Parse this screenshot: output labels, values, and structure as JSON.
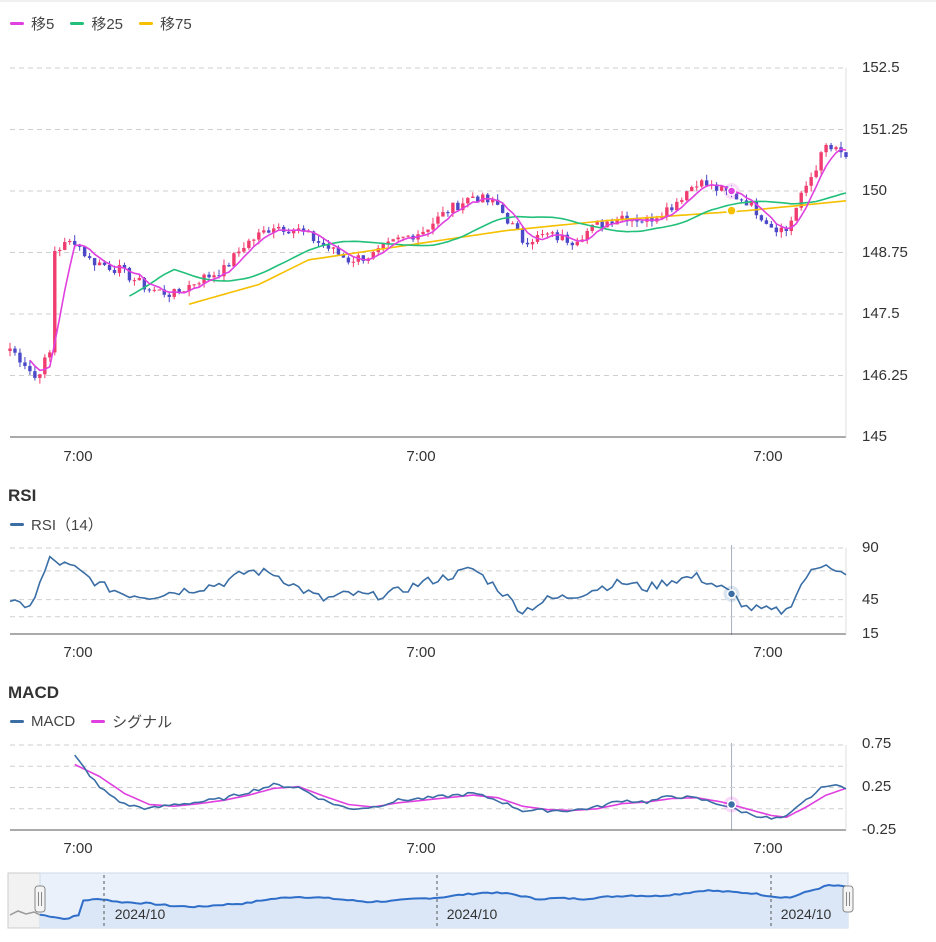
{
  "main": {
    "legend": [
      {
        "label": "移5",
        "color": "#e040e0"
      },
      {
        "label": "移25",
        "color": "#22c07a"
      },
      {
        "label": "移75",
        "color": "#f5c000"
      }
    ],
    "y_ticks": [
      "152.5",
      "151.25",
      "150",
      "148.75",
      "147.5",
      "146.25",
      "145"
    ],
    "x_ticks": [
      "7:00",
      "7:00",
      "7:00"
    ]
  },
  "rsi": {
    "title": "RSI",
    "legend": [
      {
        "label": "RSI（14）",
        "color": "#3a6ea5"
      }
    ],
    "y_ticks": [
      "90",
      "45",
      "15"
    ],
    "x_ticks": [
      "7:00",
      "7:00",
      "7:00"
    ]
  },
  "macd": {
    "title": "MACD",
    "legend": [
      {
        "label": "MACD",
        "color": "#3a6ea5"
      },
      {
        "label": "シグナル",
        "color": "#e040e0"
      }
    ],
    "y_ticks": [
      "0.75",
      "0.25",
      "-0.25"
    ],
    "x_ticks": [
      "7:00",
      "7:00",
      "7:00"
    ]
  },
  "navigator": {
    "date_labels": [
      "2024/10",
      "2024/10",
      "2024/10"
    ]
  },
  "chart_data": [
    {
      "type": "line",
      "name": "price",
      "ylim": [
        145,
        152.5
      ],
      "y_ticks": [
        152.5,
        151.25,
        150,
        148.75,
        147.5,
        146.25,
        145
      ],
      "price_keypoints": [
        [
          0,
          146.8
        ],
        [
          3,
          146.5
        ],
        [
          5,
          146.2
        ],
        [
          8,
          146.7
        ],
        [
          9,
          148.8
        ],
        [
          13,
          149.0
        ],
        [
          16,
          148.6
        ],
        [
          22,
          148.4
        ],
        [
          28,
          148.0
        ],
        [
          33,
          147.9
        ],
        [
          38,
          148.2
        ],
        [
          43,
          148.4
        ],
        [
          47,
          148.9
        ],
        [
          53,
          149.3
        ],
        [
          58,
          149.2
        ],
        [
          63,
          148.9
        ],
        [
          68,
          148.6
        ],
        [
          73,
          148.7
        ],
        [
          78,
          149.0
        ],
        [
          83,
          149.2
        ],
        [
          88,
          149.6
        ],
        [
          93,
          149.9
        ],
        [
          98,
          149.7
        ],
        [
          103,
          149.0
        ],
        [
          108,
          149.1
        ],
        [
          113,
          149.0
        ],
        [
          118,
          149.3
        ],
        [
          123,
          149.5
        ],
        [
          128,
          149.4
        ],
        [
          133,
          149.7
        ],
        [
          138,
          150.2
        ],
        [
          143,
          150.0
        ],
        [
          148,
          149.8
        ],
        [
          153,
          149.3
        ],
        [
          156,
          149.2
        ],
        [
          160,
          150.1
        ],
        [
          164,
          150.9
        ],
        [
          168,
          150.7
        ]
      ],
      "ma75_keypoints": [
        [
          36,
          147.7
        ],
        [
          50,
          148.1
        ],
        [
          60,
          148.6
        ],
        [
          80,
          148.9
        ],
        [
          100,
          149.2
        ],
        [
          120,
          149.4
        ],
        [
          148,
          149.6
        ],
        [
          168,
          149.8
        ]
      ],
      "markers": [
        {
          "series": "移5",
          "value": 150.0
        },
        {
          "series": "移75",
          "value": 149.6
        }
      ]
    },
    {
      "type": "line",
      "name": "RSI",
      "ylim": [
        15,
        90
      ],
      "y_ticks": [
        90,
        45,
        15
      ],
      "keypoints": [
        [
          0,
          45
        ],
        [
          3,
          36
        ],
        [
          5,
          48
        ],
        [
          8,
          80
        ],
        [
          13,
          72
        ],
        [
          18,
          58
        ],
        [
          23,
          50
        ],
        [
          28,
          48
        ],
        [
          33,
          52
        ],
        [
          38,
          55
        ],
        [
          43,
          60
        ],
        [
          48,
          70
        ],
        [
          53,
          68
        ],
        [
          58,
          55
        ],
        [
          63,
          45
        ],
        [
          68,
          50
        ],
        [
          73,
          48
        ],
        [
          78,
          52
        ],
        [
          83,
          60
        ],
        [
          88,
          65
        ],
        [
          93,
          72
        ],
        [
          98,
          55
        ],
        [
          103,
          35
        ],
        [
          108,
          45
        ],
        [
          113,
          48
        ],
        [
          118,
          55
        ],
        [
          123,
          60
        ],
        [
          128,
          55
        ],
        [
          133,
          62
        ],
        [
          138,
          65
        ],
        [
          143,
          55
        ],
        [
          145,
          50
        ],
        [
          148,
          38
        ],
        [
          153,
          35
        ],
        [
          156,
          35
        ],
        [
          160,
          65
        ],
        [
          164,
          78
        ],
        [
          168,
          65
        ]
      ],
      "marker": 50
    },
    {
      "type": "line",
      "name": "MACD",
      "ylim": [
        -0.25,
        0.75
      ],
      "y_ticks": [
        0.75,
        0.25,
        -0.25
      ],
      "series": [
        {
          "name": "MACD",
          "keypoints": [
            [
              13,
              0.62
            ],
            [
              18,
              0.25
            ],
            [
              23,
              0.05
            ],
            [
              28,
              0.0
            ],
            [
              33,
              0.05
            ],
            [
              38,
              0.08
            ],
            [
              43,
              0.12
            ],
            [
              48,
              0.2
            ],
            [
              53,
              0.28
            ],
            [
              58,
              0.25
            ],
            [
              63,
              0.1
            ],
            [
              68,
              0.0
            ],
            [
              73,
              0.02
            ],
            [
              78,
              0.1
            ],
            [
              83,
              0.12
            ],
            [
              88,
              0.15
            ],
            [
              93,
              0.18
            ],
            [
              98,
              0.1
            ],
            [
              103,
              -0.02
            ],
            [
              108,
              -0.02
            ],
            [
              113,
              -0.02
            ],
            [
              118,
              0.02
            ],
            [
              123,
              0.1
            ],
            [
              128,
              0.08
            ],
            [
              133,
              0.15
            ],
            [
              138,
              0.12
            ],
            [
              143,
              0.05
            ],
            [
              148,
              -0.05
            ],
            [
              153,
              -0.12
            ],
            [
              156,
              -0.1
            ],
            [
              160,
              0.1
            ],
            [
              164,
              0.28
            ],
            [
              168,
              0.25
            ]
          ]
        },
        {
          "name": "シグナル",
          "keypoints": [
            [
              13,
              0.52
            ],
            [
              18,
              0.38
            ],
            [
              23,
              0.18
            ],
            [
              28,
              0.05
            ],
            [
              33,
              0.03
            ],
            [
              38,
              0.06
            ],
            [
              43,
              0.1
            ],
            [
              48,
              0.16
            ],
            [
              53,
              0.24
            ],
            [
              58,
              0.26
            ],
            [
              63,
              0.15
            ],
            [
              68,
              0.05
            ],
            [
              73,
              0.02
            ],
            [
              78,
              0.07
            ],
            [
              83,
              0.1
            ],
            [
              88,
              0.13
            ],
            [
              93,
              0.16
            ],
            [
              98,
              0.13
            ],
            [
              103,
              0.03
            ],
            [
              108,
              -0.01
            ],
            [
              113,
              -0.02
            ],
            [
              118,
              0.0
            ],
            [
              123,
              0.06
            ],
            [
              128,
              0.08
            ],
            [
              133,
              0.12
            ],
            [
              138,
              0.13
            ],
            [
              143,
              0.08
            ],
            [
              148,
              0.0
            ],
            [
              153,
              -0.08
            ],
            [
              156,
              -0.1
            ],
            [
              160,
              0.02
            ],
            [
              164,
              0.16
            ],
            [
              168,
              0.24
            ]
          ]
        }
      ],
      "marker": 0.05
    }
  ]
}
